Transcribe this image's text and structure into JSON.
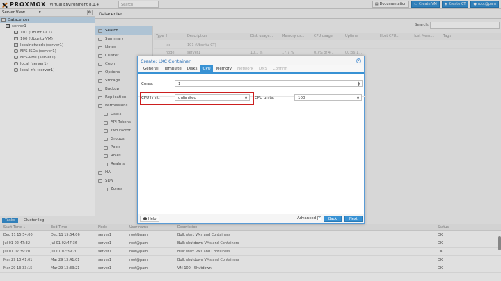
{
  "app": {
    "brand": "PROXMOX",
    "version": "Virtual Environment 8.1.4",
    "search_placeholder": "Search",
    "top_buttons": [
      {
        "label": "Documentation",
        "icon": "book-icon"
      },
      {
        "label": "Create VM",
        "icon": "monitor-icon"
      },
      {
        "label": "Create CT",
        "icon": "cube-icon"
      },
      {
        "label": "root@pam",
        "icon": "user-icon"
      }
    ]
  },
  "tree": {
    "view_label": "Server View",
    "items": [
      {
        "label": "Datacenter",
        "depth": 0,
        "type": "datacenter",
        "active": true
      },
      {
        "label": "server1",
        "depth": 1,
        "type": "server",
        "active": false
      },
      {
        "label": "101 (Ubuntu-CT)",
        "depth": 2,
        "type": "ct",
        "active": false
      },
      {
        "label": "100 (Ubuntu-VM)",
        "depth": 2,
        "type": "vm",
        "active": false
      },
      {
        "label": "localnetwork (server1)",
        "depth": 2,
        "type": "net",
        "active": false
      },
      {
        "label": "NFS-ISOs (server1)",
        "depth": 2,
        "type": "storage",
        "active": false
      },
      {
        "label": "NFS-VMs (server1)",
        "depth": 2,
        "type": "storage",
        "active": false
      },
      {
        "label": "local (server1)",
        "depth": 2,
        "type": "storage",
        "active": false
      },
      {
        "label": "local-zfs (server1)",
        "depth": 2,
        "type": "storage",
        "active": false
      }
    ]
  },
  "content": {
    "title": "Datacenter"
  },
  "dc_nav": [
    {
      "label": "Search",
      "sub": false,
      "active": true
    },
    {
      "label": "Summary",
      "sub": false,
      "active": false
    },
    {
      "label": "Notes",
      "sub": false,
      "active": false
    },
    {
      "label": "Cluster",
      "sub": false,
      "active": false
    },
    {
      "label": "Ceph",
      "sub": false,
      "active": false
    },
    {
      "label": "Options",
      "sub": false,
      "active": false
    },
    {
      "label": "Storage",
      "sub": false,
      "active": false
    },
    {
      "label": "Backup",
      "sub": false,
      "active": false
    },
    {
      "label": "Replication",
      "sub": false,
      "active": false
    },
    {
      "label": "Permissions",
      "sub": false,
      "active": false
    },
    {
      "label": "Users",
      "sub": true,
      "active": false
    },
    {
      "label": "API Tokens",
      "sub": true,
      "active": false
    },
    {
      "label": "Two Factor",
      "sub": true,
      "active": false
    },
    {
      "label": "Groups",
      "sub": true,
      "active": false
    },
    {
      "label": "Pools",
      "sub": true,
      "active": false
    },
    {
      "label": "Roles",
      "sub": true,
      "active": false
    },
    {
      "label": "Realms",
      "sub": true,
      "active": false
    },
    {
      "label": "HA",
      "sub": false,
      "active": false
    },
    {
      "label": "SDN",
      "sub": false,
      "active": false
    },
    {
      "label": "Zones",
      "sub": true,
      "active": false
    }
  ],
  "grid": {
    "search_label": "Search:",
    "columns": [
      "Type ↑",
      "Description",
      "Disk usage...",
      "Memory us...",
      "CPU usage",
      "Uptime",
      "Host CPU...",
      "Host Mem...",
      "Tags"
    ],
    "rows": [
      [
        "lxc",
        "101 (Ubuntu-CT)",
        "",
        "",
        "",
        "-",
        "",
        "",
        ""
      ],
      [
        "node",
        "server1",
        "10.1 %",
        "17.7 %",
        "0.7% of 4...",
        "00:36:1...",
        "",
        "",
        ""
      ]
    ]
  },
  "modal": {
    "title": "Create: LXC Container",
    "tabs": [
      {
        "label": "General",
        "state": "normal"
      },
      {
        "label": "Template",
        "state": "normal"
      },
      {
        "label": "Disks",
        "state": "normal"
      },
      {
        "label": "CPU",
        "state": "active"
      },
      {
        "label": "Memory",
        "state": "normal"
      },
      {
        "label": "Network",
        "state": "disabled"
      },
      {
        "label": "DNS",
        "state": "disabled"
      },
      {
        "label": "Confirm",
        "state": "disabled"
      }
    ],
    "cores_label": "Cores:",
    "cores_value": "1",
    "cpu_limit_label": "CPU limit:",
    "cpu_limit_value": "unlimited",
    "cpu_units_label": "CPU units:",
    "cpu_units_value": "100",
    "help_label": "Help",
    "advanced_label": "Advanced",
    "advanced_checked": true,
    "back_label": "Back",
    "next_label": "Next"
  },
  "tasks": {
    "tabs": [
      {
        "label": "Tasks",
        "active": true
      },
      {
        "label": "Cluster log",
        "active": false
      }
    ],
    "columns": [
      "Start Time ↓",
      "End Time",
      "Node",
      "User name",
      "Description",
      "Status"
    ],
    "rows": [
      [
        "Dec 11 15:54:00",
        "Dec 11 15:54:06",
        "server1",
        "root@pam",
        "Bulk start VMs and Containers",
        "OK"
      ],
      [
        "Jul 01 02:47:32",
        "Jul 01 02:47:36",
        "server1",
        "root@pam",
        "Bulk shutdown VMs and Containers",
        "OK"
      ],
      [
        "Jul 01 02:39:20",
        "Jul 01 02:39:20",
        "server1",
        "root@pam",
        "Bulk start VMs and Containers",
        "OK"
      ],
      [
        "Mar 29 13:41:01",
        "Mar 29 13:41:01",
        "server1",
        "root@pam",
        "Bulk shutdown VMs and Containers",
        "OK"
      ],
      [
        "Mar 29 13:33:15",
        "Mar 29 13:33:21",
        "server1",
        "root@pam",
        "VM 100 - Shutdown",
        "OK"
      ]
    ]
  },
  "colors": {
    "accent": "#3892d4",
    "highlight_box": "#cc1f1f",
    "selected_row": "#c7dff2",
    "brand_orange": "#e57000"
  }
}
